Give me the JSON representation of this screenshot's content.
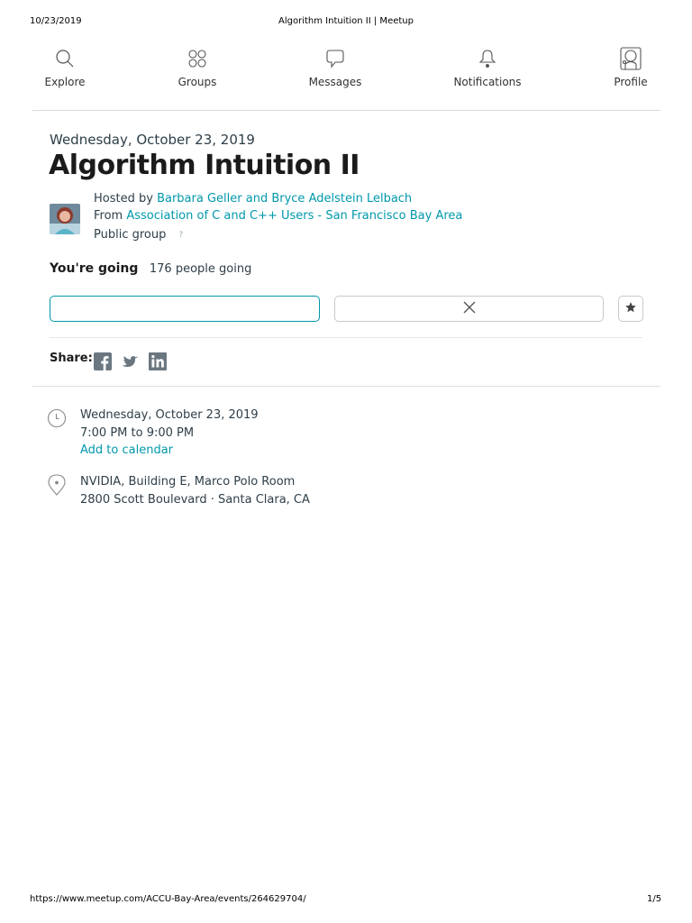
{
  "print": {
    "date": "10/23/2019",
    "title": "Algorithm Intuition II | Meetup",
    "url": "https://www.meetup.com/ACCU-Bay-Area/events/264629704/",
    "page": "1/5"
  },
  "nav": {
    "explore": "Explore",
    "groups": "Groups",
    "messages": "Messages",
    "notifications": "Notifications",
    "profile": "Profile"
  },
  "event": {
    "date_heading": "Wednesday, October 23, 2019",
    "title": "Algorithm Intuition II",
    "hosted_prefix": "Hosted by",
    "hosts": "Barbara Geller and Bryce Adelstein Lelbach",
    "from_prefix": "From",
    "group": "Association of C and C++ Users - San Francisco Bay Area",
    "group_type": "Public group",
    "help_mark": "?"
  },
  "rsvp": {
    "status": "You're going",
    "count": "176 people going"
  },
  "share": {
    "label": "Share:",
    "icons": [
      "facebook-icon",
      "twitter-icon",
      "linkedin-icon"
    ]
  },
  "details": {
    "date": "Wednesday, October 23, 2019",
    "time": "7:00 PM to 9:00 PM",
    "calendar_link": "Add to calendar",
    "venue": "NVIDIA, Building E, Marco Polo Room",
    "address": "2800 Scott Boulevard · Santa Clara, CA"
  },
  "colors": {
    "accent": "#0098ab",
    "text": "#2e3e48",
    "title": "#1b1b1b",
    "border": "#c9c9c9"
  }
}
